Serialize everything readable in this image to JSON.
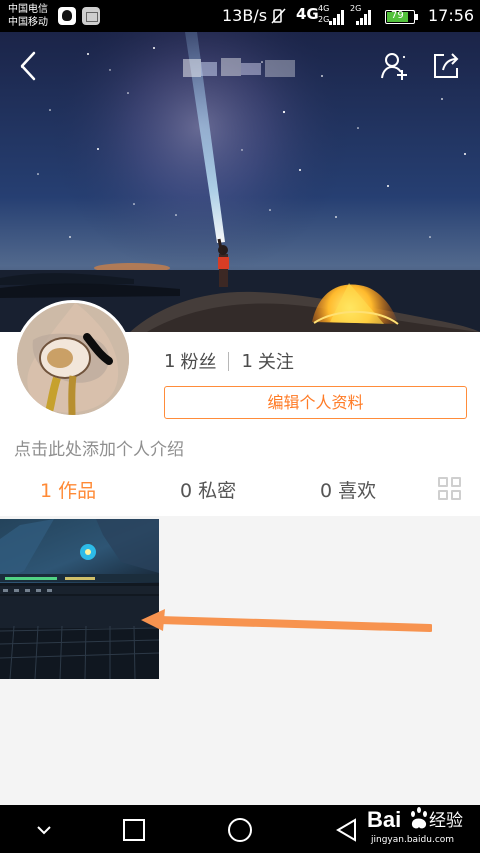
{
  "status_bar": {
    "carrier_top": "中国电信",
    "carrier_bottom": "中国移动",
    "network_speed": "13B/s",
    "signal_primary": "4G",
    "signal_small_top": "4G",
    "signal_small_bottom": "2G",
    "signal_secondary_label": "2G",
    "battery_percent": "79",
    "time": "17:56",
    "battery_fraction": 0.79,
    "battery_color": "#53c13c"
  },
  "header": {
    "back_icon": "chevron-left-icon",
    "title_blurred": true,
    "add_user_icon": "add-user-icon",
    "share_icon": "share-icon"
  },
  "profile": {
    "followers_count": "1",
    "followers_label": "粉丝",
    "following_count": "1",
    "following_label": "关注",
    "edit_button_label": "编辑个人资料",
    "intro_placeholder": "点击此处添加个人介绍",
    "accent_color": "#ff7c27"
  },
  "tabs": [
    {
      "label": "1 作品",
      "active": true
    },
    {
      "label": "0 私密",
      "active": false
    },
    {
      "label": "0 喜欢",
      "active": false
    }
  ],
  "view_toggle_icon": "grid-icon",
  "content": {
    "item_count": 1
  },
  "navigation": {
    "icons": [
      "chevron-down-icon",
      "recent-apps-icon",
      "home-icon",
      "back-triangle-icon"
    ]
  },
  "watermark": {
    "brand_text": "Bai",
    "brand_suffix": "经验",
    "url": "jingyan.baidu.com"
  }
}
